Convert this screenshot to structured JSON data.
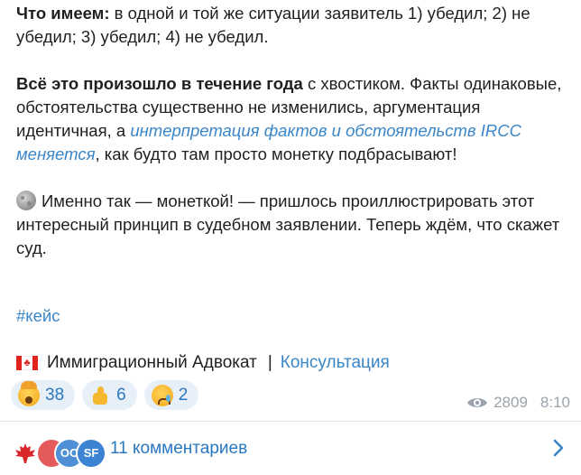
{
  "post": {
    "p1_bold": "Что имеем:",
    "p1_text": " в одной и той же ситуации заявитель 1) убедил; 2) не убедил; 3) убедил; 4) не убедил.",
    "p2_bold": "Всё это произошло в течение года",
    "p2_text": " с хвостиком. Факты одинаковые, обстоятельства существенно не изменились, аргументация идентичная, а ",
    "p2_italic": "интерпретация фактов и обстоятельств IRCC меняется",
    "p2_tail": ", как будто там просто монетку подбрасывают!",
    "p3_text": "Именно так — монеткой! — пришлось проиллюстрировать этот интересный принцип в судебном заявлении. Теперь ждём, что скажет суд.",
    "p3_icon": "moon-coin-emoji",
    "hashtag": "#кейс"
  },
  "signature": {
    "flag_icon": "canada-flag-icon",
    "name": "Иммиграционный Адвокат",
    "separator": "|",
    "link": "Консультация"
  },
  "reactions": [
    {
      "emoji": "shocked-face-emoji",
      "count": "38"
    },
    {
      "emoji": "thumbs-up-emoji",
      "count": "6"
    },
    {
      "emoji": "crying-face-emoji",
      "count": "2"
    }
  ],
  "meta": {
    "views": "2809",
    "time": "8:10"
  },
  "comments": {
    "avatars": [
      "",
      "",
      "OO",
      "SF"
    ],
    "label": "11 комментариев"
  },
  "colors": {
    "link": "#3a86c8",
    "accent": "#2a78c0",
    "reaction_bg": "#e7f0f8",
    "meta": "#9aa3ab"
  }
}
